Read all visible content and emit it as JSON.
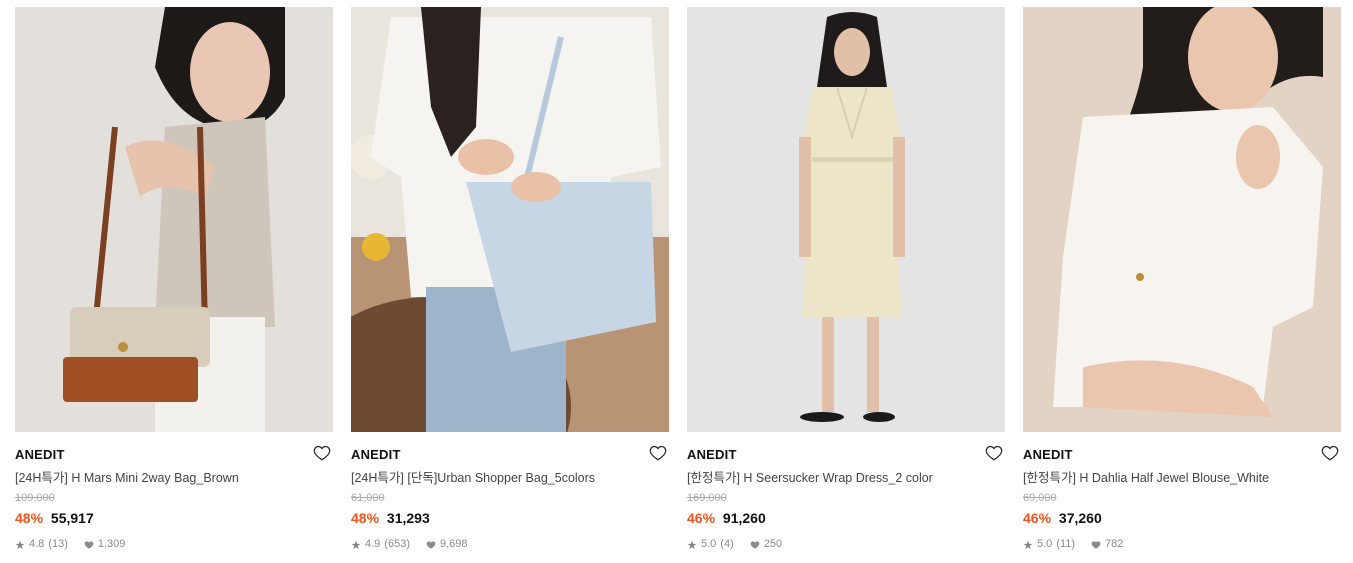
{
  "products": [
    {
      "brand": "ANEDIT",
      "name": "[24H특가] H Mars Mini 2way Bag_Brown",
      "original_price": "109,000",
      "discount": "48%",
      "price": "55,917",
      "rating": "4.8",
      "reviews": "(13)",
      "likes": "1,309",
      "photo_bg": "#e6e3df"
    },
    {
      "brand": "ANEDIT",
      "name": "[24H특가] [단독]Urban Shopper Bag_5colors",
      "original_price": "61,000",
      "discount": "48%",
      "price": "31,293",
      "rating": "4.9",
      "reviews": "(653)",
      "likes": "9,698",
      "photo_bg": "#e9e4dc"
    },
    {
      "brand": "ANEDIT",
      "name": "[한정특가] H Seersucker Wrap Dress_2 color",
      "original_price": "169,000",
      "discount": "46%",
      "price": "91,260",
      "rating": "5.0",
      "reviews": "(4)",
      "likes": "250",
      "photo_bg": "#e4e4e4"
    },
    {
      "brand": "ANEDIT",
      "name": "[한정특가] H Dahlia Half Jewel Blouse_White",
      "original_price": "69,000",
      "discount": "46%",
      "price": "37,260",
      "rating": "5.0",
      "reviews": "(11)",
      "likes": "782",
      "photo_bg": "#e2d3c4"
    }
  ],
  "icons": {
    "wishlist": "heart-outline-icon",
    "rating": "star-icon",
    "likes": "heart-filled-icon"
  },
  "colors": {
    "discount": "#f0541e",
    "meta": "#8a8a8a",
    "strike": "#aaaaaa"
  }
}
